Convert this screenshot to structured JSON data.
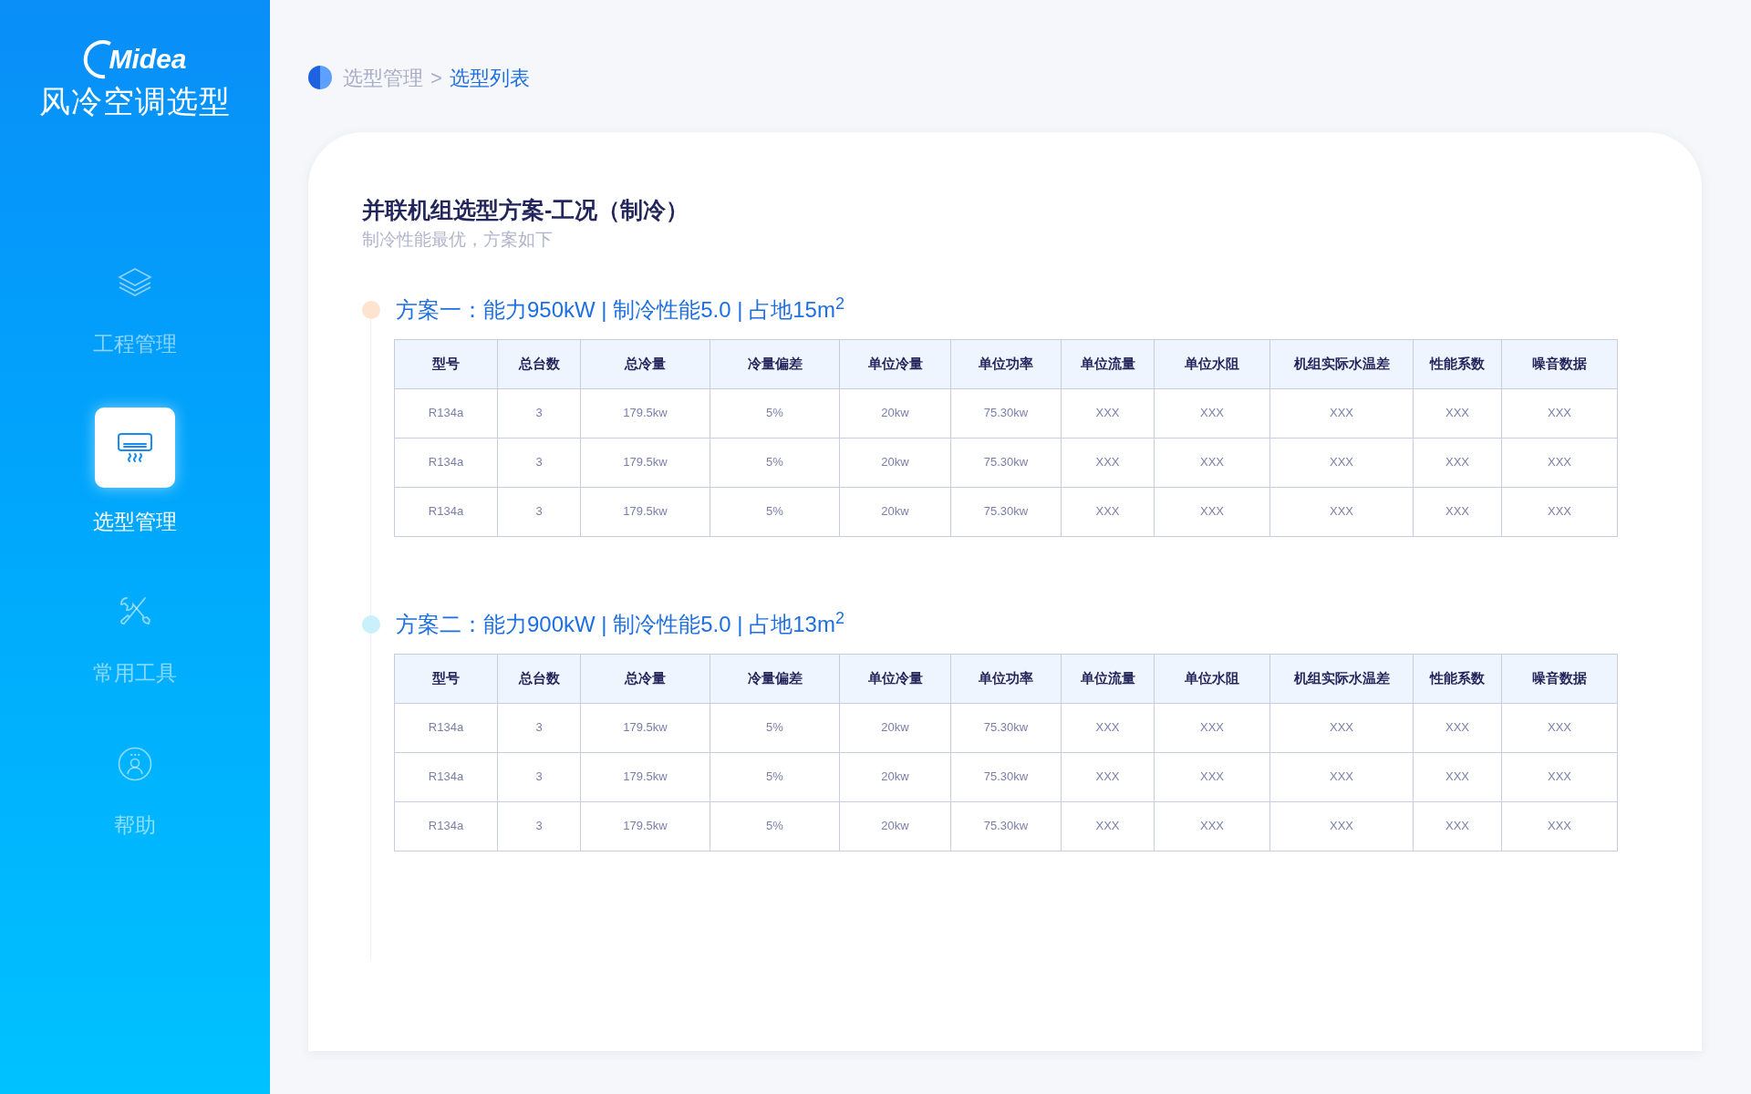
{
  "sidebar": {
    "logo": "Midea",
    "app_title": "风冷空调选型",
    "items": [
      {
        "label": "工程管理",
        "kind": "layers",
        "selected": false
      },
      {
        "label": "选型管理",
        "kind": "aircon",
        "selected": true
      },
      {
        "label": "常用工具",
        "kind": "tools",
        "selected": false
      },
      {
        "label": "帮助",
        "kind": "help",
        "selected": false
      }
    ]
  },
  "breadcrumb": {
    "separator": ">",
    "items": [
      {
        "label": "选型管理",
        "selected": false
      },
      {
        "label": "选型列表",
        "selected": true
      }
    ]
  },
  "card": {
    "title": "并联机组选型方案-工况（制冷）",
    "subtitle": "制冷性能最优，方案如下",
    "plans": [
      {
        "heading": "方案一：能力950kW | 制冷性能5.0 | 占地15m$^{2}$",
        "color": "#fde3d0",
        "table": {
          "columns": [
            "型号",
            "总台数",
            "总冷量",
            "冷量偏差",
            "单位冷量",
            "单位功率",
            "单位流量",
            "单位水阻",
            "机组实际水温差",
            "性能系数",
            "噪音数据"
          ],
          "rows": [
            [
              "R134a",
              "3",
              "179.5kw",
              "5%",
              "20kw",
              "75.30kw",
              "XXX",
              "XXX",
              "XXX",
              "XXX",
              "XXX"
            ],
            [
              "R134a",
              "3",
              "179.5kw",
              "5%",
              "20kw",
              "75.30kw",
              "XXX",
              "XXX",
              "XXX",
              "XXX",
              "XXX"
            ],
            [
              "R134a",
              "3",
              "179.5kw",
              "5%",
              "20kw",
              "75.30kw",
              "XXX",
              "XXX",
              "XXX",
              "XXX",
              "XXX"
            ]
          ]
        }
      },
      {
        "heading": "方案二：能力900kW | 制冷性能5.0 | 占地13m$^{2}$",
        "color": "#c9f0fb",
        "table": {
          "columns": [
            "型号",
            "总台数",
            "总冷量",
            "冷量偏差",
            "单位冷量",
            "单位功率",
            "单位流量",
            "单位水阻",
            "机组实际水温差",
            "性能系数",
            "噪音数据"
          ],
          "rows": [
            [
              "R134a",
              "3",
              "179.5kw",
              "5%",
              "20kw",
              "75.30kw",
              "XXX",
              "XXX",
              "XXX",
              "XXX",
              "XXX"
            ],
            [
              "R134a",
              "3",
              "179.5kw",
              "5%",
              "20kw",
              "75.30kw",
              "XXX",
              "XXX",
              "XXX",
              "XXX",
              "XXX"
            ],
            [
              "R134a",
              "3",
              "179.5kw",
              "5%",
              "20kw",
              "75.30kw",
              "XXX",
              "XXX",
              "XXX",
              "XXX",
              "XXX"
            ]
          ]
        }
      }
    ]
  }
}
